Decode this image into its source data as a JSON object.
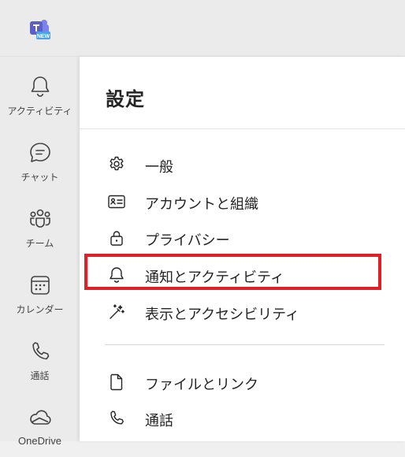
{
  "app": {
    "logo_badge": "NEW",
    "accent": "#5b5fc7",
    "highlight": "#e01f26"
  },
  "rail": {
    "items": [
      {
        "label": "アクティビティ",
        "icon": "bell-icon"
      },
      {
        "label": "チャット",
        "icon": "chat-icon"
      },
      {
        "label": "チーム",
        "icon": "teams-icon"
      },
      {
        "label": "カレンダー",
        "icon": "calendar-icon"
      },
      {
        "label": "通話",
        "icon": "phone-icon"
      },
      {
        "label": "OneDrive",
        "icon": "cloud-icon"
      }
    ]
  },
  "settings": {
    "title": "設定",
    "items": [
      {
        "label": "一般",
        "icon": "gear-icon"
      },
      {
        "label": "アカウントと組織",
        "icon": "id-card-icon"
      },
      {
        "label": "プライバシー",
        "icon": "lock-icon"
      },
      {
        "label": "通知とアクティビティ",
        "icon": "bell-icon"
      },
      {
        "label": "表示とアクセシビリティ",
        "icon": "magic-wand-icon"
      },
      {
        "label": "ファイルとリンク",
        "icon": "file-icon"
      },
      {
        "label": "通話",
        "icon": "phone-icon"
      }
    ]
  }
}
